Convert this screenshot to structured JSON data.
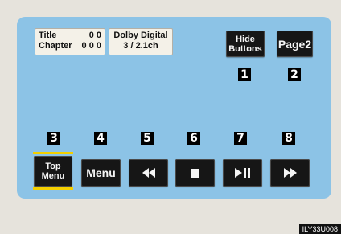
{
  "info": {
    "title_label": "Title",
    "title_value": "0 0",
    "chapter_label": "Chapter",
    "chapter_value": "0 0 0",
    "audio_format": "Dolby Digital",
    "audio_channels": "3 / 2.1ch"
  },
  "buttons": {
    "hide_line1": "Hide",
    "hide_line2": "Buttons",
    "page2": "Page2",
    "top_menu_line1": "Top",
    "top_menu_line2": "Menu",
    "menu": "Menu"
  },
  "icons": {
    "rewind": "rewind-icon",
    "stop": "stop-icon",
    "play_pause": "play-pause-icon",
    "fast_forward": "fast-forward-icon"
  },
  "callouts": [
    "1",
    "2",
    "3",
    "4",
    "5",
    "6",
    "7",
    "8"
  ],
  "figure_code": "ILY33U008",
  "colors": {
    "panel": "#8cc3e6",
    "button": "#161616",
    "highlight": "#f3cf00",
    "background": "#e6e3dc"
  }
}
